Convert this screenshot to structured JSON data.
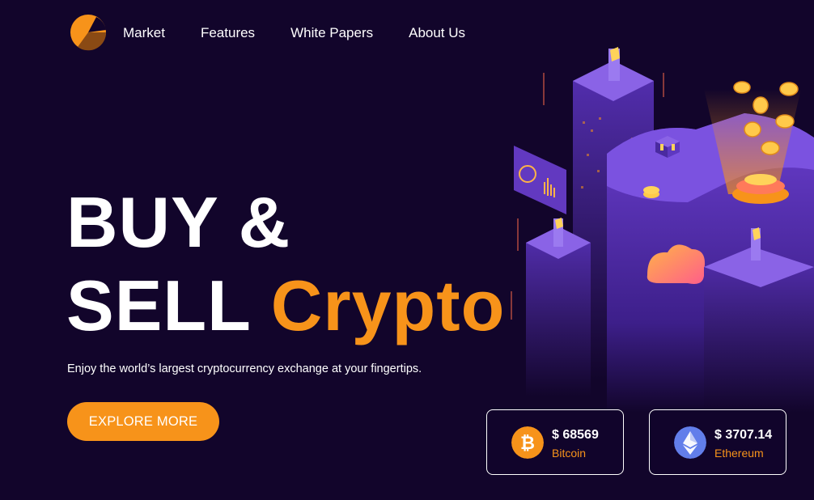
{
  "nav": {
    "logo_icon": "crypto-logo-icon",
    "items": [
      {
        "label": "Market"
      },
      {
        "label": "Features"
      },
      {
        "label": "White Papers"
      },
      {
        "label": "About Us"
      }
    ]
  },
  "hero": {
    "line1": "BUY &",
    "line2_white": "SELL",
    "line2_accent": "Crypto",
    "subtitle": "Enjoy the world’s largest cryptocurrency exchange at your fingertips.",
    "cta_label": "EXPLORE MORE"
  },
  "coins": {
    "bitcoin": {
      "price": "$ 68569",
      "name": "Bitcoin",
      "icon": "bitcoin-icon",
      "color": "#f7931a"
    },
    "ethereum": {
      "price": "$ 3707.14",
      "name": "Ethereum",
      "icon": "ethereum-icon",
      "color": "#627eea"
    }
  },
  "colors": {
    "background": "#12052b",
    "accent": "#f7931a",
    "illustration_purple": "#6b3fd0"
  }
}
